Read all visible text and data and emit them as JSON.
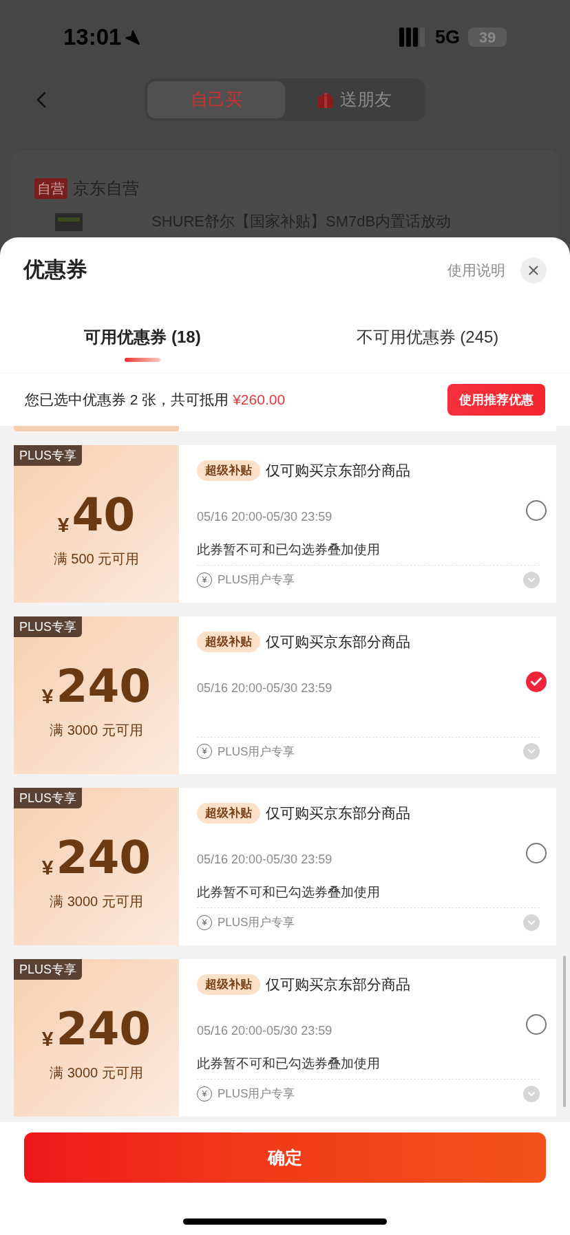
{
  "status_bar": {
    "time": "13:01",
    "network": "5G",
    "battery": "39"
  },
  "header": {
    "segments": [
      {
        "label": "自己买",
        "selected": true
      },
      {
        "label": "送朋友",
        "selected": false
      }
    ]
  },
  "store": {
    "badge": "自营",
    "name": "京东自营",
    "product_title": "SHURE舒尔【国家补贴】SM7dB内置话放动"
  },
  "sheet": {
    "title": "优惠券",
    "help_link": "使用说明",
    "tabs": [
      {
        "label": "可用优惠券 (18)",
        "selected": true
      },
      {
        "label": "不可用优惠券 (245)",
        "selected": false
      }
    ],
    "summary": {
      "text": "您已选中优惠券 2 张，共可抵用 ",
      "amount": "¥260.00",
      "button": "使用推荐优惠"
    },
    "coupons": [
      {
        "tag": "PLUS专享",
        "currency": "¥",
        "amount": "40",
        "condition": "满 500 元可用",
        "badge": "超级补贴",
        "title": "仅可购买京东部分商品",
        "validity": "05/16 20:00-05/30 23:59",
        "note": "此券暂不可和已勾选券叠加使用",
        "footer_icon": "¥",
        "footer": "PLUS用户专享",
        "selected": false
      },
      {
        "tag": "PLUS专享",
        "currency": "¥",
        "amount": "240",
        "condition": "满 3000 元可用",
        "badge": "超级补贴",
        "title": "仅可购买京东部分商品",
        "validity": "05/16 20:00-05/30 23:59",
        "footer_icon": "¥",
        "footer": "PLUS用户专享",
        "selected": true
      },
      {
        "tag": "PLUS专享",
        "currency": "¥",
        "amount": "240",
        "condition": "满 3000 元可用",
        "badge": "超级补贴",
        "title": "仅可购买京东部分商品",
        "validity": "05/16 20:00-05/30 23:59",
        "note": "此券暂不可和已勾选券叠加使用",
        "footer_icon": "¥",
        "footer": "PLUS用户专享",
        "selected": false
      },
      {
        "tag": "PLUS专享",
        "currency": "¥",
        "amount": "240",
        "condition": "满 3000 元可用",
        "badge": "超级补贴",
        "title": "仅可购买京东部分商品",
        "validity": "05/16 20:00-05/30 23:59",
        "note": "此券暂不可和已勾选券叠加使用",
        "footer_icon": "¥",
        "footer": "PLUS用户专享",
        "selected": false
      }
    ],
    "confirm_button": "确定"
  }
}
